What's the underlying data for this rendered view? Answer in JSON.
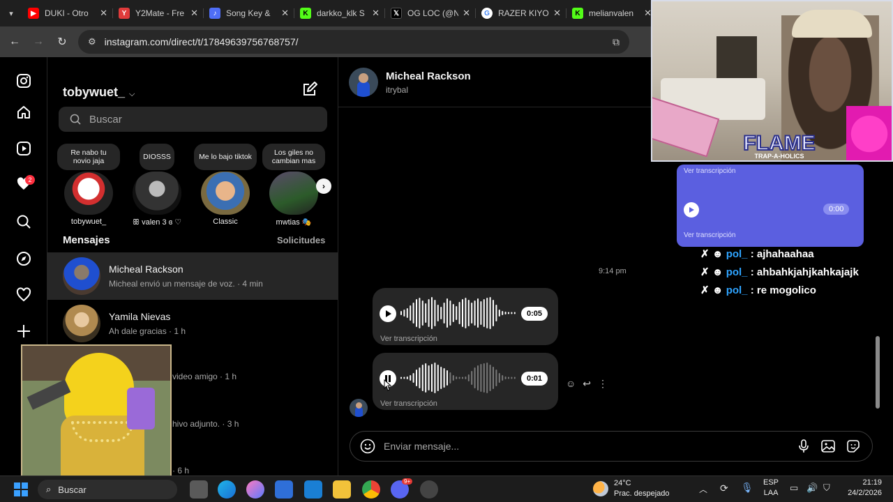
{
  "browser": {
    "tabs": [
      {
        "title": "DUKI - Otro",
        "icon": "youtube-icon",
        "color": "#ff0000"
      },
      {
        "title": "Y2Mate - Fre",
        "icon": "y2mate-icon",
        "color": "#e03b3b"
      },
      {
        "title": "Song Key &",
        "icon": "music-note-icon",
        "color": "#4f6ef7"
      },
      {
        "title": "darkko_klk S",
        "icon": "kick-icon",
        "color": "#53fc18"
      },
      {
        "title": "OG LOC (@N",
        "icon": "x-icon",
        "color": "#ffffff"
      },
      {
        "title": "RAZER KIYO",
        "icon": "google-icon",
        "color": "#4285f4"
      },
      {
        "title": "melianvalen",
        "icon": "kick-icon",
        "color": "#53fc18"
      }
    ],
    "url": "instagram.com/direct/t/17849639756768757/"
  },
  "sidebar": {
    "username": "tobywuet_",
    "search_placeholder": "Buscar",
    "notification_count": "2",
    "notes": [
      {
        "text": "Re nabo tu novio jaja",
        "name": "tobywuet_"
      },
      {
        "text": "DIOSSS",
        "name": "ꕥ valen 3 ɞ ♡"
      },
      {
        "text": "Me lo bajo tiktok",
        "name": "Classic"
      },
      {
        "text": "Los giles no cambian mas",
        "name": "mwtias 🎭"
      }
    ],
    "messages_title": "Mensajes",
    "requests_label": "Solicitudes",
    "conversations": [
      {
        "name": "Micheal Rackson",
        "preview": "Micheal envió un mensaje de voz. · 4 min"
      },
      {
        "name": "Yamila Nievas",
        "preview": "Ah dale gracias · 1 h"
      }
    ],
    "partial_previews": [
      "video amigo · 1 h",
      "hivo adjunto. · 3 h",
      "· 6 h"
    ]
  },
  "chat": {
    "name": "Micheal Rackson",
    "handle": "itrybal",
    "timestamp": "9:14 pm",
    "voice_messages": [
      {
        "duration": "0:05",
        "transcript_label": "Ver transcripción",
        "state": "paused"
      },
      {
        "duration": "0:01",
        "transcript_label": "Ver transcripción",
        "state": "playing"
      }
    ],
    "composer_placeholder": "Enviar mensaje..."
  },
  "overlay": {
    "banner_title": "FLAME",
    "banner_sub": "TRAP-A-HOLICS",
    "faded_duration": "0:00",
    "faded_labels": [
      "Ver transcripción",
      "Ver transcripción"
    ],
    "chat_lines": [
      {
        "user": "pol_",
        "text": "ajhahaahaa"
      },
      {
        "user": "pol_",
        "text": "ahbahkjahjkahkajajk"
      },
      {
        "user": "pol_",
        "text": "re mogolico"
      }
    ]
  },
  "taskbar": {
    "search_placeholder": "Buscar",
    "weather_temp": "24°C",
    "weather_desc": "Prac. despejado",
    "lang_top": "ESP",
    "lang_bottom": "LAA",
    "time": "21:19",
    "date": "24/2/2026",
    "discord_badge": "9+"
  }
}
